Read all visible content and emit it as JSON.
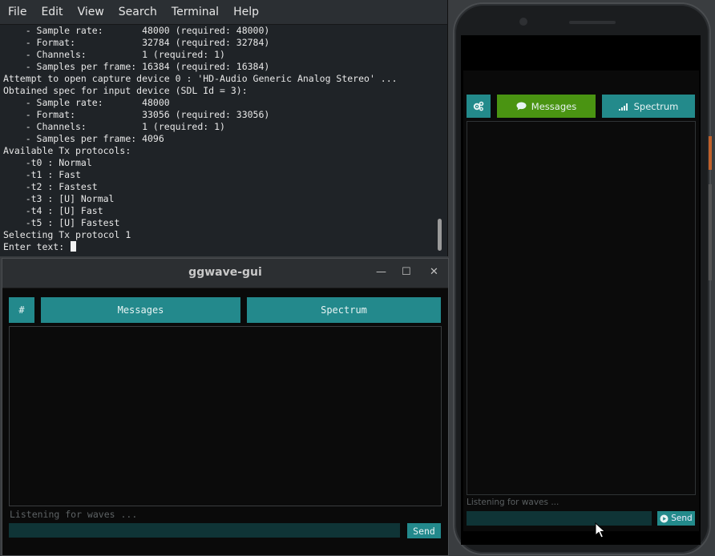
{
  "terminal": {
    "menu": [
      "File",
      "Edit",
      "View",
      "Search",
      "Terminal",
      "Help"
    ],
    "lines": [
      "    - Sample rate:       48000 (required: 48000)",
      "    - Format:            32784 (required: 32784)",
      "    - Channels:          1 (required: 1)",
      "    - Samples per frame: 16384 (required: 16384)",
      "Attempt to open capture device 0 : 'HD-Audio Generic Analog Stereo' ...",
      "Obtained spec for input device (SDL Id = 3):",
      "    - Sample rate:       48000",
      "    - Format:            33056 (required: 33056)",
      "    - Channels:          1 (required: 1)",
      "    - Samples per frame: 4096",
      "Available Tx protocols:",
      "    -t0 : Normal",
      "    -t1 : Fast",
      "    -t2 : Fastest",
      "    -t3 : [U] Normal",
      "    -t4 : [U] Fast",
      "    -t5 : [U] Fastest",
      "Selecting Tx protocol 1"
    ],
    "prompt": "Enter text: "
  },
  "desktop_gui": {
    "title": "ggwave-gui",
    "window_controls": [
      "—",
      "☐",
      "✕"
    ],
    "settings_label": "#",
    "messages_label": "Messages",
    "spectrum_label": "Spectrum",
    "status": "Listening for waves ...",
    "send_label": "Send",
    "input_value": ""
  },
  "phone_app": {
    "settings_icon": "gears-icon",
    "messages_icon": "comment-icon",
    "messages_label": "Messages",
    "spectrum_icon": "signal-bars-icon",
    "spectrum_label": "Spectrum",
    "status": "Listening for waves ...",
    "send_icon": "play-circle-icon",
    "send_label": "Send",
    "input_value": "",
    "active_tab": "Messages"
  },
  "colors": {
    "accent_teal": "#23898c",
    "active_green": "#4a9412",
    "input_bg": "#0f3436",
    "terminal_bg": "#1f2327"
  }
}
